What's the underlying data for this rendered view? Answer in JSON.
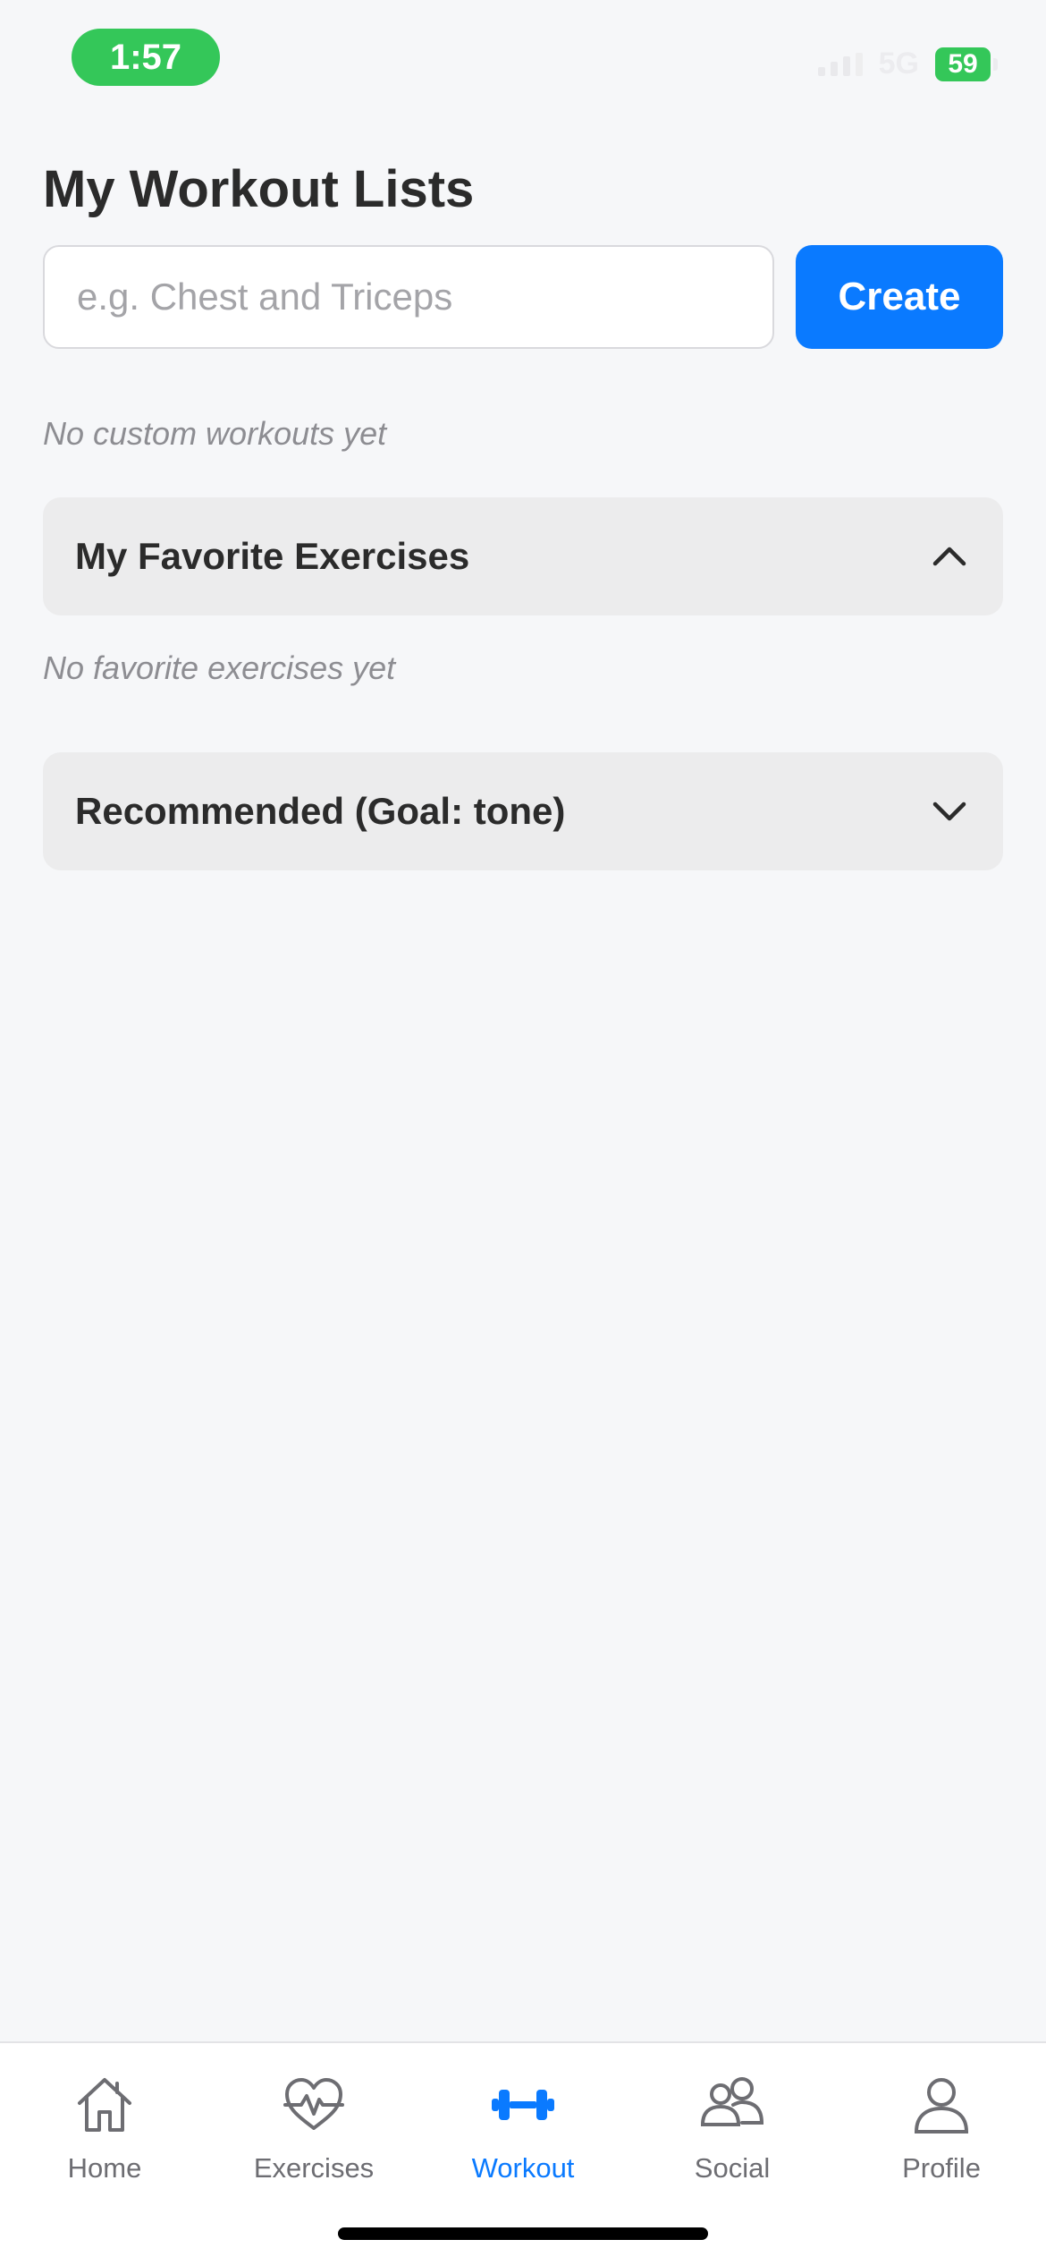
{
  "status_bar": {
    "time": "1:57",
    "network": "5G",
    "battery": "59"
  },
  "page": {
    "title": "My Workout Lists"
  },
  "create_form": {
    "placeholder": "e.g. Chest and Triceps",
    "value": "",
    "create_label": "Create"
  },
  "custom_workouts": {
    "empty_text": "No custom workouts yet"
  },
  "favorites": {
    "title": "My Favorite Exercises",
    "expanded": true,
    "empty_text": "No favorite exercises yet"
  },
  "recommended": {
    "title": "Recommended (Goal: tone)",
    "expanded": false
  },
  "tab_bar": {
    "active_color": "#0a7aff",
    "inactive_color": "#6d6d72",
    "items": [
      {
        "label": "Home",
        "icon": "home-icon",
        "active": false
      },
      {
        "label": "Exercises",
        "icon": "heart-pulse-icon",
        "active": false
      },
      {
        "label": "Workout",
        "icon": "dumbbell-icon",
        "active": true
      },
      {
        "label": "Social",
        "icon": "people-icon",
        "active": false
      },
      {
        "label": "Profile",
        "icon": "person-icon",
        "active": false
      }
    ]
  }
}
